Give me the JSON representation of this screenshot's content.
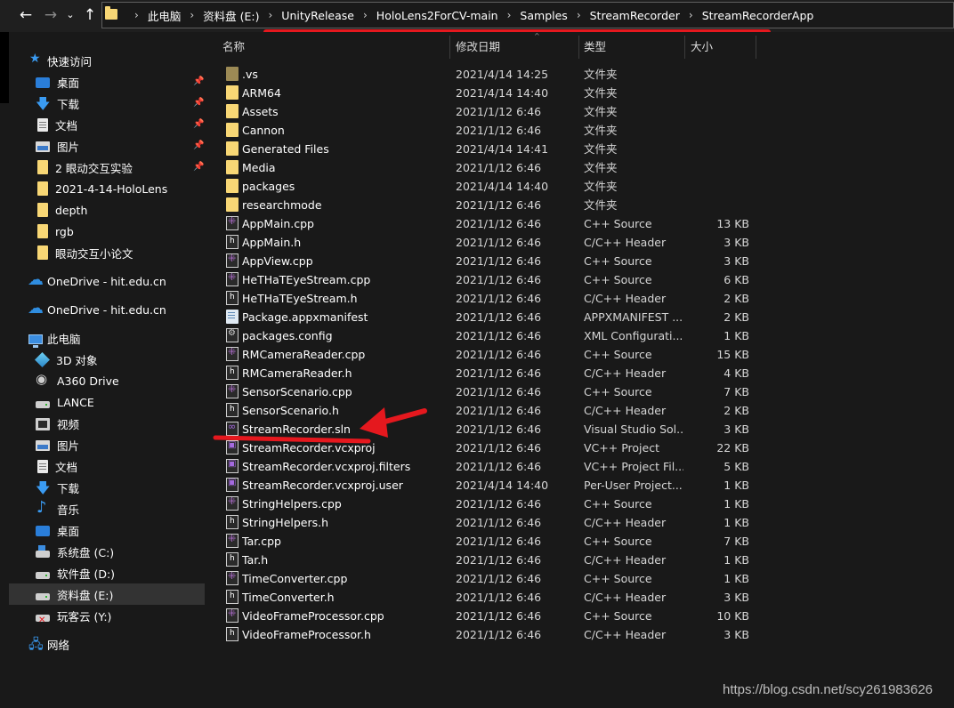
{
  "address": {
    "crumbs": [
      "此电脑",
      "资料盘 (E:)",
      "UnityRelease",
      "HoloLens2ForCV-main",
      "Samples",
      "StreamRecorder",
      "StreamRecorderApp"
    ]
  },
  "sidebar": {
    "quick_access": "快速访问",
    "items": [
      {
        "label": "桌面"
      },
      {
        "label": "下载"
      },
      {
        "label": "文档"
      },
      {
        "label": "图片"
      },
      {
        "label": "2 眼动交互实验"
      },
      {
        "label": "2021-4-14-HoloLens"
      },
      {
        "label": "depth"
      },
      {
        "label": "rgb"
      },
      {
        "label": "眼动交互小论文"
      }
    ],
    "onedrive_1": "OneDrive - hit.edu.cn",
    "onedrive_2": "OneDrive - hit.edu.cn",
    "this_pc": "此电脑",
    "pc_items": [
      {
        "label": "3D 对象"
      },
      {
        "label": "A360 Drive"
      },
      {
        "label": "LANCE"
      },
      {
        "label": "视频"
      },
      {
        "label": "图片"
      },
      {
        "label": "文档"
      },
      {
        "label": "下载"
      },
      {
        "label": "音乐"
      },
      {
        "label": "桌面"
      },
      {
        "label": "系统盘 (C:)"
      },
      {
        "label": "软件盘 (D:)"
      },
      {
        "label": "资料盘 (E:)"
      },
      {
        "label": "玩客云 (Y:)"
      }
    ],
    "network": "网络"
  },
  "columns": {
    "name": "名称",
    "date": "修改日期",
    "type": "类型",
    "size": "大小"
  },
  "files": [
    {
      "name": ".vs",
      "date": "2021/4/14 14:25",
      "type": "文件夹",
      "size": "",
      "icon": "folder-dark"
    },
    {
      "name": "ARM64",
      "date": "2021/4/14 14:40",
      "type": "文件夹",
      "size": "",
      "icon": "folder"
    },
    {
      "name": "Assets",
      "date": "2021/1/12 6:46",
      "type": "文件夹",
      "size": "",
      "icon": "folder"
    },
    {
      "name": "Cannon",
      "date": "2021/1/12 6:46",
      "type": "文件夹",
      "size": "",
      "icon": "folder"
    },
    {
      "name": "Generated Files",
      "date": "2021/4/14 14:41",
      "type": "文件夹",
      "size": "",
      "icon": "folder"
    },
    {
      "name": "Media",
      "date": "2021/1/12 6:46",
      "type": "文件夹",
      "size": "",
      "icon": "folder"
    },
    {
      "name": "packages",
      "date": "2021/4/14 14:40",
      "type": "文件夹",
      "size": "",
      "icon": "folder"
    },
    {
      "name": "researchmode",
      "date": "2021/1/12 6:46",
      "type": "文件夹",
      "size": "",
      "icon": "folder"
    },
    {
      "name": "AppMain.cpp",
      "date": "2021/1/12 6:46",
      "type": "C++ Source",
      "size": "13 KB",
      "icon": "cpp"
    },
    {
      "name": "AppMain.h",
      "date": "2021/1/12 6:46",
      "type": "C/C++ Header",
      "size": "3 KB",
      "icon": "h"
    },
    {
      "name": "AppView.cpp",
      "date": "2021/1/12 6:46",
      "type": "C++ Source",
      "size": "3 KB",
      "icon": "cpp"
    },
    {
      "name": "HeTHaTEyeStream.cpp",
      "date": "2021/1/12 6:46",
      "type": "C++ Source",
      "size": "6 KB",
      "icon": "cpp"
    },
    {
      "name": "HeTHaTEyeStream.h",
      "date": "2021/1/12 6:46",
      "type": "C/C++ Header",
      "size": "2 KB",
      "icon": "h"
    },
    {
      "name": "Package.appxmanifest",
      "date": "2021/1/12 6:46",
      "type": "APPXMANIFEST ...",
      "size": "2 KB",
      "icon": "manifest"
    },
    {
      "name": "packages.config",
      "date": "2021/1/12 6:46",
      "type": "XML Configurati...",
      "size": "1 KB",
      "icon": "config"
    },
    {
      "name": "RMCameraReader.cpp",
      "date": "2021/1/12 6:46",
      "type": "C++ Source",
      "size": "15 KB",
      "icon": "cpp"
    },
    {
      "name": "RMCameraReader.h",
      "date": "2021/1/12 6:46",
      "type": "C/C++ Header",
      "size": "4 KB",
      "icon": "h"
    },
    {
      "name": "SensorScenario.cpp",
      "date": "2021/1/12 6:46",
      "type": "C++ Source",
      "size": "7 KB",
      "icon": "cpp"
    },
    {
      "name": "SensorScenario.h",
      "date": "2021/1/12 6:46",
      "type": "C/C++ Header",
      "size": "2 KB",
      "icon": "h"
    },
    {
      "name": "StreamRecorder.sln",
      "date": "2021/1/12 6:46",
      "type": "Visual Studio Sol...",
      "size": "3 KB",
      "icon": "sln"
    },
    {
      "name": "StreamRecorder.vcxproj",
      "date": "2021/1/12 6:46",
      "type": "VC++ Project",
      "size": "22 KB",
      "icon": "proj"
    },
    {
      "name": "StreamRecorder.vcxproj.filters",
      "date": "2021/1/12 6:46",
      "type": "VC++ Project Fil...",
      "size": "5 KB",
      "icon": "proj"
    },
    {
      "name": "StreamRecorder.vcxproj.user",
      "date": "2021/4/14 14:40",
      "type": "Per-User Project...",
      "size": "1 KB",
      "icon": "proj"
    },
    {
      "name": "StringHelpers.cpp",
      "date": "2021/1/12 6:46",
      "type": "C++ Source",
      "size": "1 KB",
      "icon": "cpp"
    },
    {
      "name": "StringHelpers.h",
      "date": "2021/1/12 6:46",
      "type": "C/C++ Header",
      "size": "1 KB",
      "icon": "h"
    },
    {
      "name": "Tar.cpp",
      "date": "2021/1/12 6:46",
      "type": "C++ Source",
      "size": "7 KB",
      "icon": "cpp"
    },
    {
      "name": "Tar.h",
      "date": "2021/1/12 6:46",
      "type": "C/C++ Header",
      "size": "1 KB",
      "icon": "h"
    },
    {
      "name": "TimeConverter.cpp",
      "date": "2021/1/12 6:46",
      "type": "C++ Source",
      "size": "1 KB",
      "icon": "cpp"
    },
    {
      "name": "TimeConverter.h",
      "date": "2021/1/12 6:46",
      "type": "C/C++ Header",
      "size": "3 KB",
      "icon": "h"
    },
    {
      "name": "VideoFrameProcessor.cpp",
      "date": "2021/1/12 6:46",
      "type": "C++ Source",
      "size": "10 KB",
      "icon": "cpp"
    },
    {
      "name": "VideoFrameProcessor.h",
      "date": "2021/1/12 6:46",
      "type": "C/C++ Header",
      "size": "3 KB",
      "icon": "h"
    }
  ],
  "watermark": "https://blog.csdn.net/scy261983626",
  "colors": {
    "annotation": "#e5181e",
    "folder": "#f8d775",
    "background": "#191919"
  }
}
